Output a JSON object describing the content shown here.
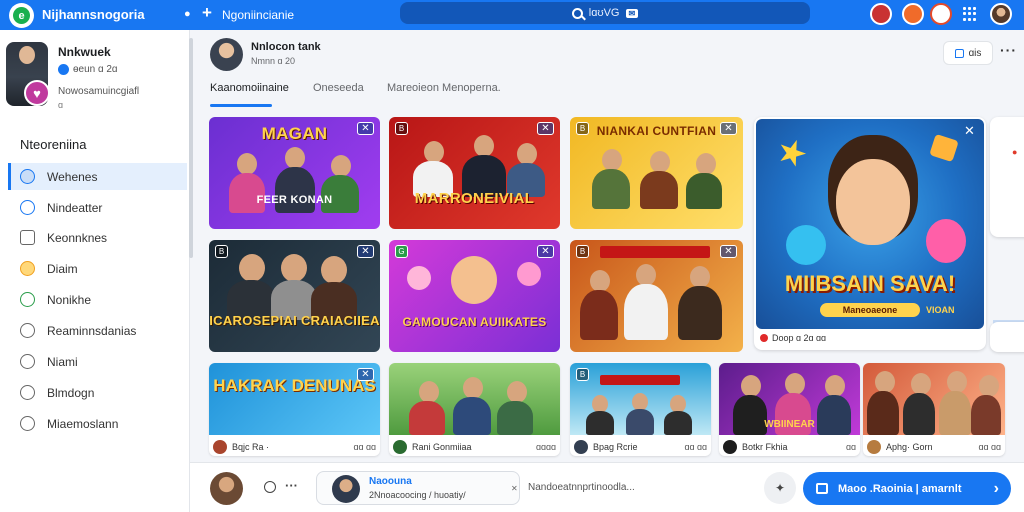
{
  "header": {
    "app_title": "Nijhannsnogoria",
    "nav_link": "Ngoniincianie",
    "search_text": "lɑʊVG",
    "search_badge": "✉"
  },
  "profile": {
    "name": "Nnkwuek",
    "meta": "ɵeun ɑ 2ɑ",
    "bio": "Nowosamuincgiafl",
    "bio2": "ɑ"
  },
  "sidebar": {
    "section_title": "Nteoreniina",
    "items": [
      {
        "label": "Wehenes"
      },
      {
        "label": "Nindeatter"
      },
      {
        "label": "Keonnknes"
      },
      {
        "label": "Diaim"
      },
      {
        "label": "Nonikhe"
      },
      {
        "label": "Reaminnsdanias"
      },
      {
        "label": "Niami"
      },
      {
        "label": "Blmdogn"
      },
      {
        "label": "Miaemoslann"
      }
    ]
  },
  "page": {
    "name": "Nnlocon tank",
    "sub": "Nmnn ɑ 20",
    "header_button": "ɑis",
    "tabs": [
      {
        "label": "Kaanomoiinaine"
      },
      {
        "label": "Oneseeda"
      },
      {
        "label": "Mareoieon Menoperna."
      }
    ]
  },
  "cards": [
    {
      "title": "MAGAN",
      "sub": "FEER KONAN",
      "colors": [
        "#6b2fd1",
        "#a13df0"
      ]
    },
    {
      "title": "MARRONEIVIAL",
      "sub": "",
      "colors": [
        "#b81616",
        "#e0392c"
      ]
    },
    {
      "title": "NIANKAI CUNTFIAN",
      "sub": "",
      "colors": [
        "#f1b823",
        "#ffdf6b"
      ]
    },
    {
      "title": "ICAROSEPIAI CRAIACIIEA",
      "sub": "",
      "colors": [
        "#1c2b37",
        "#324655"
      ]
    },
    {
      "title": "GAMOUCAN AUIIKATES",
      "sub": "",
      "colors": [
        "#d43ad8",
        "#7b2fd6"
      ]
    },
    {
      "title": "",
      "sub": "",
      "colors": [
        "#c8561a",
        "#f3b14a"
      ]
    }
  ],
  "feature": {
    "title": "MIIBSAIN SAVA!",
    "badge": "Maneoaeone",
    "badge2": "VIOAN",
    "footer": "Doop ɑ 2ɑ ɑɑ"
  },
  "caption_cards": [
    {
      "headline": "HAKRAK DENUNAS",
      "user": "Bqjc Ra ·",
      "stat": "ɑɑ ɑɑ",
      "colors": [
        "#1f92d9",
        "#5cc6f7"
      ],
      "avatar": "#a9452d"
    },
    {
      "headline": "",
      "user": "Rani Gonmiiaa",
      "stat": "ɑɑɑɑ",
      "colors": [
        "#4f9b3f",
        "#9ad27a"
      ],
      "avatar": "#2a6b30"
    },
    {
      "headline": "",
      "user": "Bpag Rcrie",
      "stat": "ɑɑ ɑɑ",
      "colors": [
        "#2aa0d8",
        "#bfe8f5"
      ],
      "avatar": "#333f51"
    },
    {
      "headline": "WBIINEAR",
      "user": "Botkr Fkhia",
      "stat": "ɑɑ",
      "colors": [
        "#5c1d8c",
        "#c03ad8"
      ],
      "avatar": "#1d1d1d"
    },
    {
      "headline": "",
      "user": "Aphg· Gorn",
      "stat": "ɑɑ ɑɑ",
      "colors": [
        "#d35a3a",
        "#ffb38a"
      ],
      "avatar": "#b67b3f"
    }
  ],
  "bottom": {
    "msg_name": "Naoouna",
    "msg_text": "2Nnoacoocing / huoatiy/",
    "input_placeholder": "Nandoeatnnprtinoodla...",
    "cta": "Maoo .Raoinia | amarnlt"
  },
  "colors": {
    "brand": "#1877f2",
    "sidebar_active": "#e4effd"
  }
}
